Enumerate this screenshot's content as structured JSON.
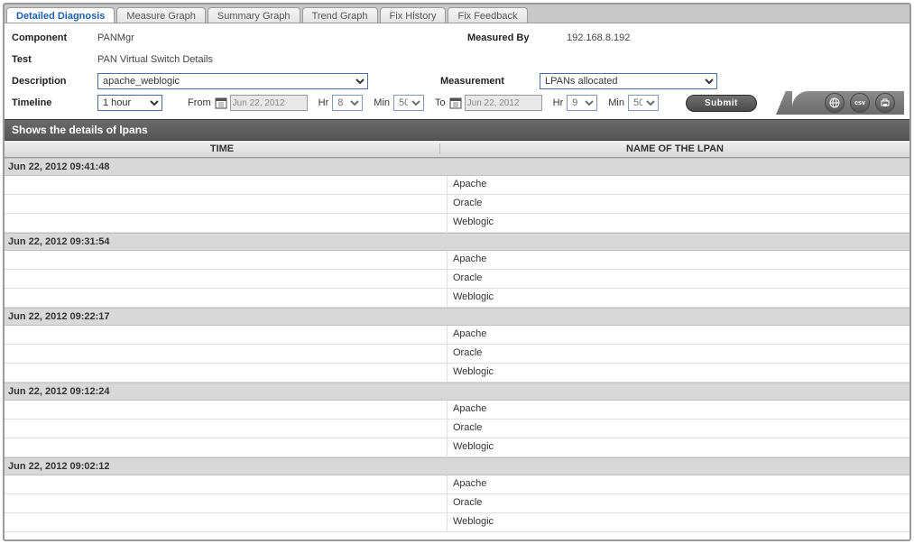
{
  "tabs": {
    "items": [
      {
        "label": "Detailed Diagnosis",
        "active": true
      },
      {
        "label": "Measure Graph",
        "active": false
      },
      {
        "label": "Summary Graph",
        "active": false
      },
      {
        "label": "Trend Graph",
        "active": false
      },
      {
        "label": "Fix History",
        "active": false
      },
      {
        "label": "Fix Feedback",
        "active": false
      }
    ]
  },
  "form": {
    "component_label": "Component",
    "component_value": "PANMgr",
    "measured_by_label": "Measured By",
    "measured_by_value": "192.168.8.192",
    "test_label": "Test",
    "test_value": "PAN Virtual Switch Details",
    "description_label": "Description",
    "description_value": "apache_weblogic",
    "measurement_label": "Measurement",
    "measurement_value": "LPANs allocated",
    "timeline_label": "Timeline",
    "timeline_value": "1 hour",
    "from_label": "From",
    "from_date": "Jun 22, 2012",
    "from_hr_label": "Hr",
    "from_hr": "8",
    "from_min_label": "Min",
    "from_min": "50",
    "to_label": "To",
    "to_date": "Jun 22, 2012",
    "to_hr_label": "Hr",
    "to_hr": "9",
    "to_min_label": "Min",
    "to_min": "50",
    "submit": "Submit"
  },
  "icons": {
    "csv": "csv"
  },
  "panel": {
    "title": "Shows the details of lpans",
    "col_time": "TIME",
    "col_name": "NAME OF THE LPAN"
  },
  "data_rows": [
    {
      "time": "Jun 22, 2012 09:41:48",
      "items": [
        "Apache",
        "Oracle",
        "Weblogic"
      ]
    },
    {
      "time": "Jun 22, 2012 09:31:54",
      "items": [
        "Apache",
        "Oracle",
        "Weblogic"
      ]
    },
    {
      "time": "Jun 22, 2012 09:22:17",
      "items": [
        "Apache",
        "Oracle",
        "Weblogic"
      ]
    },
    {
      "time": "Jun 22, 2012 09:12:24",
      "items": [
        "Apache",
        "Oracle",
        "Weblogic"
      ]
    },
    {
      "time": "Jun 22, 2012 09:02:12",
      "items": [
        "Apache",
        "Oracle",
        "Weblogic"
      ]
    }
  ]
}
